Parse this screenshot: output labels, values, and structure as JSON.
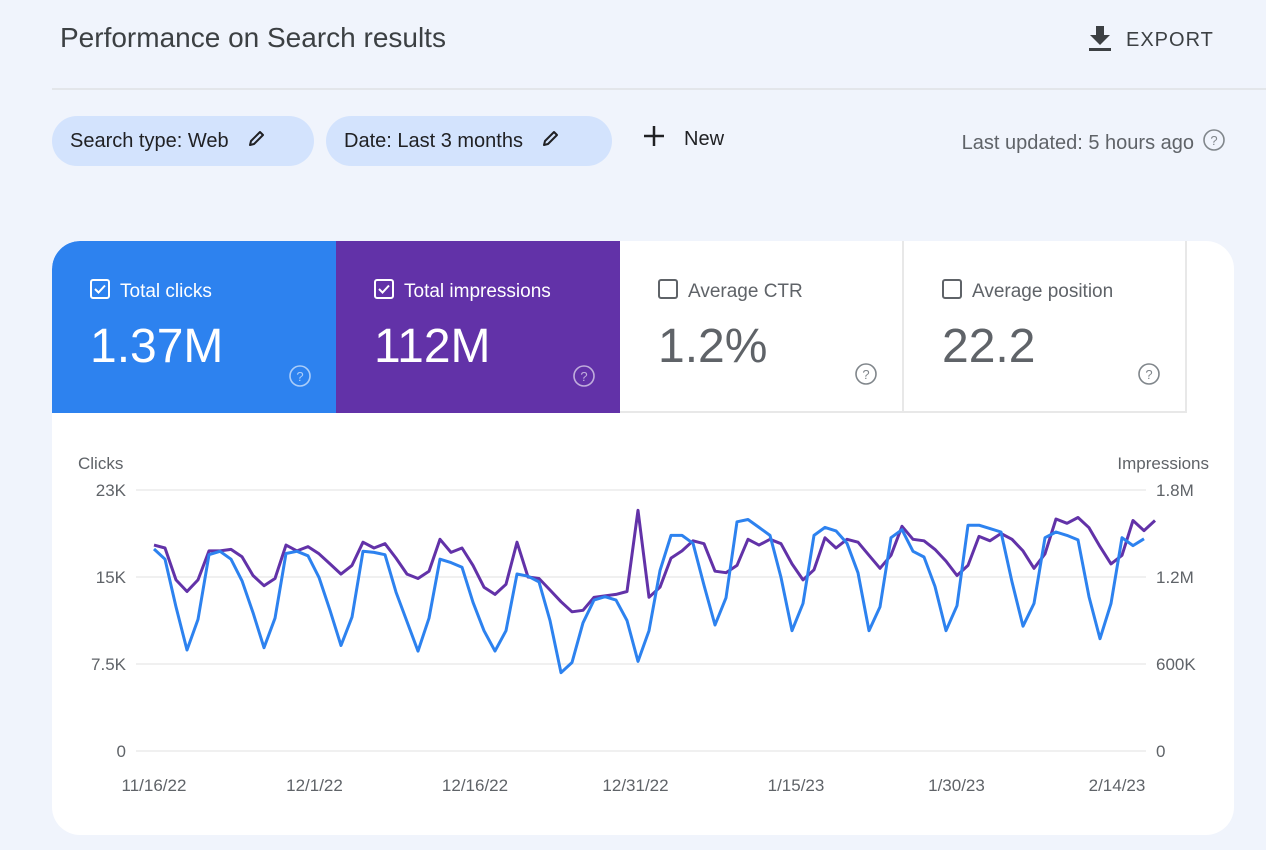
{
  "header": {
    "title": "Performance on Search results",
    "export_label": "EXPORT"
  },
  "filters": {
    "search_type": "Search type: Web",
    "date": "Date: Last 3 months",
    "new_label": "New",
    "last_updated": "Last updated: 5 hours ago"
  },
  "metrics": [
    {
      "label": "Total clicks",
      "value": "1.37M",
      "checked": true,
      "color": "#2d82ef"
    },
    {
      "label": "Total impressions",
      "value": "112M",
      "checked": true,
      "color": "#6232a8"
    },
    {
      "label": "Average CTR",
      "value": "1.2%",
      "checked": false
    },
    {
      "label": "Average position",
      "value": "22.2",
      "checked": false
    }
  ],
  "chart_data": {
    "type": "line",
    "xlabel": "",
    "ylabel": "Clicks",
    "ylabel_right": "Impressions",
    "ylim": [
      0,
      23000
    ],
    "ylim_right": [
      0,
      1800000
    ],
    "yticks": [
      "0",
      "7.5K",
      "15K",
      "23K"
    ],
    "yticks_right": [
      "0",
      "600K",
      "1.2M",
      "1.8M"
    ],
    "xticks": [
      "11/16/22",
      "12/1/22",
      "12/16/22",
      "12/31/22",
      "1/15/23",
      "1/30/23",
      "2/14/23"
    ],
    "grid": true,
    "series": [
      {
        "name": "Clicks",
        "axis": "left",
        "color": "#2d82ef",
        "values": [
          17800,
          16900,
          12700,
          8900,
          11600,
          17300,
          17600,
          16900,
          15000,
          12200,
          9100,
          11700,
          17400,
          17600,
          17200,
          15300,
          12400,
          9300,
          11800,
          17600,
          17500,
          17300,
          14000,
          11400,
          8800,
          11700,
          16900,
          16600,
          16200,
          13100,
          10600,
          8800,
          10600,
          15600,
          15400,
          14900,
          11500,
          6900,
          7800,
          11300,
          13300,
          13600,
          13300,
          11500,
          7900,
          10600,
          15900,
          19000,
          19000,
          18300,
          14600,
          11100,
          13500,
          20200,
          20400,
          19700,
          19000,
          15300,
          10600,
          13000,
          19000,
          19700,
          19400,
          18300,
          15700,
          10600,
          12700,
          18800,
          19500,
          17600,
          17100,
          14500,
          10600,
          12800,
          19900,
          19900,
          19600,
          19300,
          14900,
          11000,
          13000,
          18800,
          19300,
          19000,
          18600,
          13600,
          9900,
          13000,
          18800,
          18100,
          18700
        ]
      },
      {
        "name": "Impressions",
        "axis": "right",
        "color": "#6232a8",
        "values": [
          1420000,
          1400000,
          1180000,
          1100000,
          1180000,
          1380000,
          1380000,
          1390000,
          1340000,
          1210000,
          1140000,
          1190000,
          1420000,
          1380000,
          1410000,
          1360000,
          1290000,
          1220000,
          1280000,
          1440000,
          1400000,
          1430000,
          1330000,
          1220000,
          1190000,
          1240000,
          1460000,
          1370000,
          1400000,
          1280000,
          1130000,
          1080000,
          1150000,
          1440000,
          1200000,
          1190000,
          1110000,
          1030000,
          960000,
          970000,
          1060000,
          1070000,
          1080000,
          1100000,
          1660000,
          1060000,
          1130000,
          1330000,
          1380000,
          1450000,
          1430000,
          1240000,
          1230000,
          1280000,
          1460000,
          1420000,
          1460000,
          1430000,
          1290000,
          1180000,
          1250000,
          1470000,
          1400000,
          1460000,
          1440000,
          1350000,
          1260000,
          1350000,
          1550000,
          1460000,
          1450000,
          1390000,
          1310000,
          1210000,
          1280000,
          1480000,
          1450000,
          1500000,
          1460000,
          1380000,
          1260000,
          1360000,
          1600000,
          1570000,
          1610000,
          1540000,
          1410000,
          1290000,
          1350000,
          1590000,
          1520000,
          1590000
        ]
      }
    ]
  }
}
